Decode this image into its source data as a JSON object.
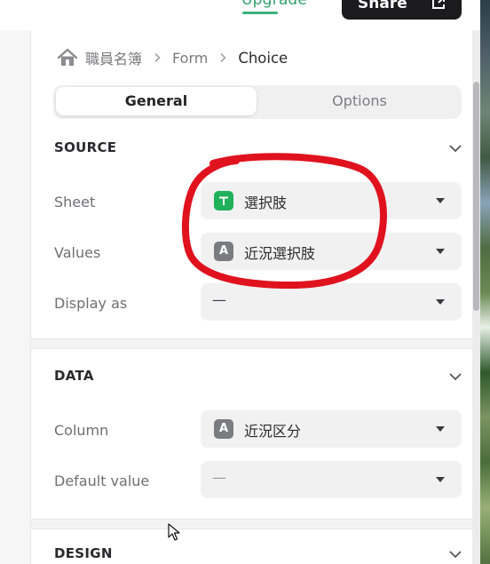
{
  "header": {
    "upgrade_label": "Upgrade",
    "share_label": "Share"
  },
  "breadcrumb": {
    "app": "職員名簿",
    "section": "Form",
    "current": "Choice"
  },
  "tabs": {
    "general": "General",
    "options": "Options",
    "active": "General"
  },
  "source": {
    "title": "SOURCE",
    "sheet_label": "Sheet",
    "sheet_value": "選択肢",
    "values_label": "Values",
    "values_value": "近況選択肢",
    "values_type_glyph": "A",
    "display_as_label": "Display as",
    "display_as_value": "—"
  },
  "data": {
    "title": "DATA",
    "column_label": "Column",
    "column_value": "近況区分",
    "column_type_glyph": "A",
    "default_value_label": "Default value",
    "default_value_value": "—"
  },
  "design": {
    "title": "DESIGN"
  },
  "colors": {
    "accent_green": "#20b15a",
    "upgrade_green": "#2e9f6b",
    "annotation_red": "#e0121e",
    "share_button_bg": "#1b1b1d"
  },
  "icons": {
    "home": "home-icon",
    "breadcrumb_separator": "chevron-right-icon",
    "section_toggle": "chevron-down-icon",
    "select_caret": "caret-down-icon",
    "sheet_type": "sheet-icon",
    "text_column_type": "text-column-icon",
    "share": "share-icon"
  }
}
